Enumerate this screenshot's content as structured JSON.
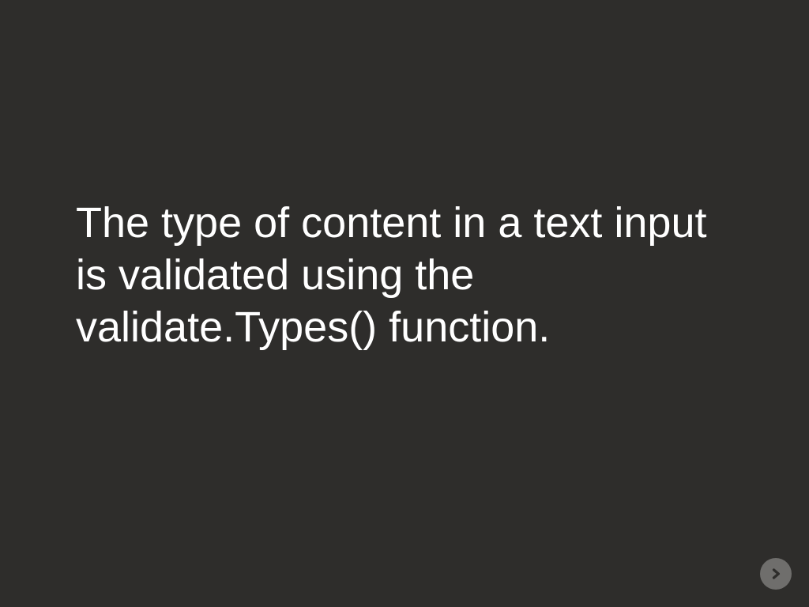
{
  "slide": {
    "body": "The type of content in a text input is validated using the validate.Types() function."
  },
  "nav": {
    "next_label": "Next"
  },
  "colors": {
    "background": "#2e2d2b",
    "text": "#ffffff",
    "button_bg": "#6f6e6c",
    "button_arrow": "#2e2d2b"
  }
}
